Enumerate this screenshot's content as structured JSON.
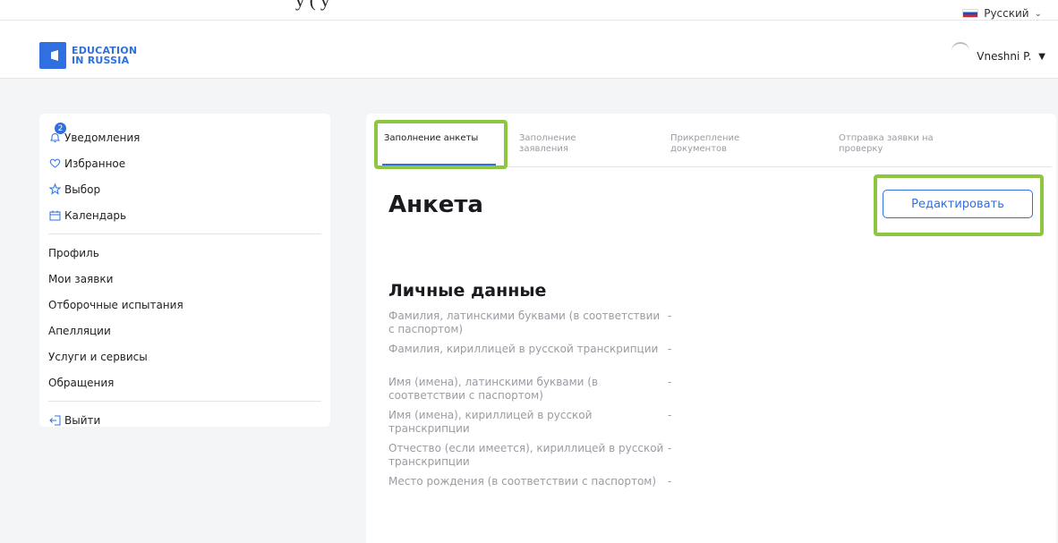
{
  "doc_fragment": "y                                                                                                 (                      y",
  "language": {
    "label": "Русский"
  },
  "header": {
    "logo_line1": "EDUCATION",
    "logo_line2": "IN RUSSIA",
    "user_name": "Vneshni P."
  },
  "sidebar": {
    "notifications_badge": "2",
    "group1": [
      {
        "label": "Уведомления",
        "icon": "bell-icon"
      },
      {
        "label": "Избранное",
        "icon": "heart-icon"
      },
      {
        "label": "Выбор",
        "icon": "star-icon"
      },
      {
        "label": "Календарь",
        "icon": "calendar-icon"
      }
    ],
    "group2": [
      {
        "label": "Профиль"
      },
      {
        "label": "Мои заявки"
      },
      {
        "label": "Отборочные испытания"
      },
      {
        "label": "Апелляции"
      },
      {
        "label": "Услуги и сервисы"
      },
      {
        "label": "Обращения"
      }
    ],
    "logout": {
      "label": "Выйти",
      "icon": "logout-icon"
    }
  },
  "tabs": [
    {
      "label": "Заполнение анкеты",
      "active": true
    },
    {
      "label": "Заполнение заявления",
      "active": false
    },
    {
      "label": "Прикрепление документов",
      "active": false
    },
    {
      "label": "Отправка заявки на проверку",
      "active": false
    }
  ],
  "main": {
    "title": "Анкета",
    "edit_button": "Редактировать",
    "section_title": "Личные данные",
    "fields": [
      {
        "label": "Фамилия, латинскими буквами (в соответствии с паспортом)",
        "value": "-"
      },
      {
        "label": "Фамилия, кириллицей в русской транскрипции",
        "value": "-"
      },
      {
        "label": "Имя (имена), латинскими буквами (в соответствии с паспортом)",
        "value": "-"
      },
      {
        "label": "Имя (имена), кириллицей в русской транскрипции",
        "value": "-"
      },
      {
        "label": "Отчество (если имеется), кириллицей в русской транскрипции",
        "value": "-"
      },
      {
        "label": "Место рождения (в соответствии с паспортом)",
        "value": "-"
      }
    ]
  },
  "colors": {
    "accent": "#2f6fe0",
    "highlight": "#8dc63f",
    "muted_text": "#9a9ca3"
  }
}
